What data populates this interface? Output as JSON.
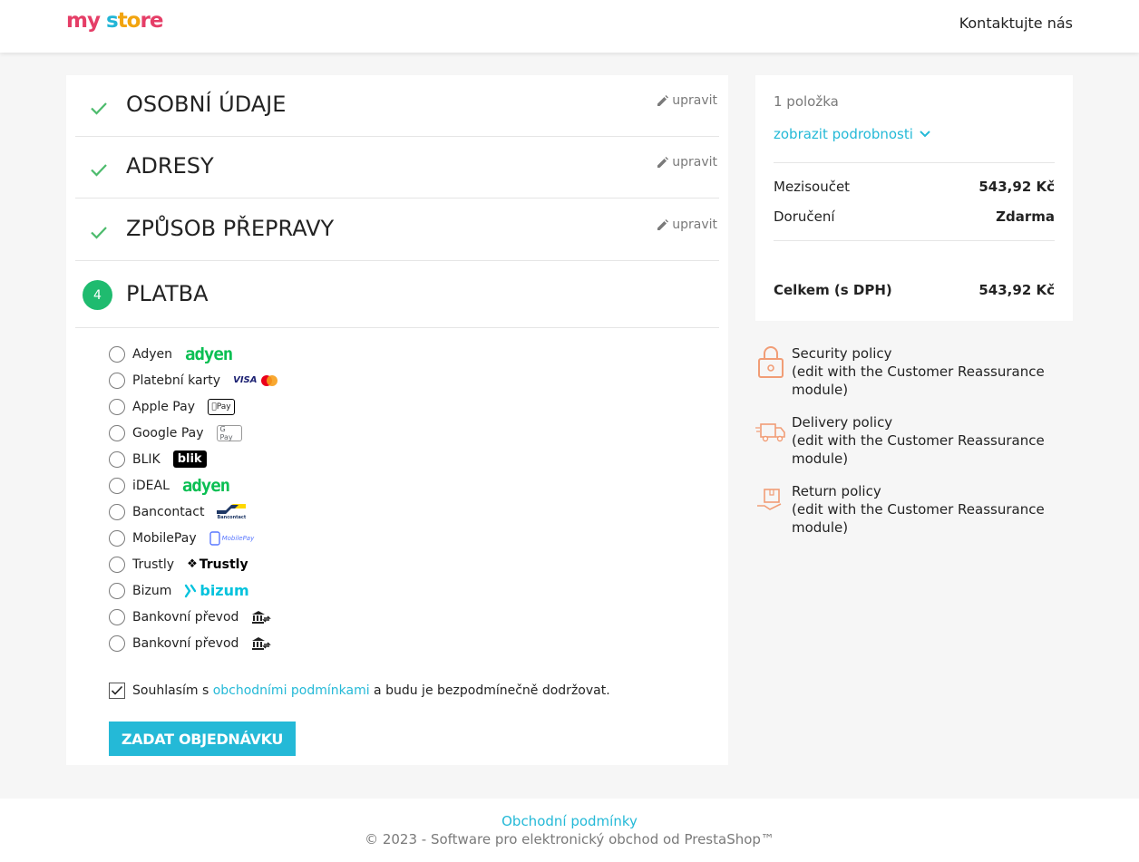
{
  "header": {
    "logo": {
      "part1": "my",
      "part2": " ",
      "part3": "s",
      "part4": "to",
      "part5": "re"
    },
    "contact": "Kontaktujte nás"
  },
  "steps": [
    {
      "title": "OSOBNÍ ÚDAJE",
      "edit": "upravit"
    },
    {
      "title": "ADRESY",
      "edit": "upravit"
    },
    {
      "title": "ZPŮSOB PŘEPRAVY",
      "edit": "upravit"
    },
    {
      "title": "PLATBA",
      "number": "4"
    }
  ],
  "payments": [
    {
      "label": "Adyen",
      "logo": "adyen"
    },
    {
      "label": "Platební karty",
      "logo": "VISA"
    },
    {
      "label": "Apple Pay",
      "logo": "Pay"
    },
    {
      "label": "Google Pay",
      "logo": "G Pay"
    },
    {
      "label": "BLIK",
      "logo": "blik"
    },
    {
      "label": "iDEAL",
      "logo": "adyen"
    },
    {
      "label": "Bancontact",
      "logo": "Bancontact"
    },
    {
      "label": "MobilePay",
      "logo": "MobilePay"
    },
    {
      "label": "Trustly",
      "logo": "Trustly"
    },
    {
      "label": "Bizum",
      "logo": "bizum"
    },
    {
      "label": "Bankovní převod",
      "logo": "bank-transfer-icon"
    },
    {
      "label": "Bankovní převod",
      "logo": "bank-transfer-icon"
    }
  ],
  "terms": {
    "before": "Souhlasím s ",
    "link": "obchodními podmínkami",
    "after": " a budu je bezpodmínečně dodržovat."
  },
  "order_button": "ZADAT OBJEDNÁVKU",
  "summary": {
    "items": "1 položka",
    "details": "zobrazit podrobnosti",
    "subtotal_label": "Mezisoučet",
    "subtotal_value": "543,92 Kč",
    "shipping_label": "Doručení",
    "shipping_value": "Zdarma",
    "total_label": "Celkem (s DPH)",
    "total_value": "543,92 Kč"
  },
  "reassurance": [
    {
      "title": "Security policy",
      "desc": "(edit with the Customer Reassurance module)",
      "icon": "lock-icon"
    },
    {
      "title": "Delivery policy",
      "desc": "(edit with the Customer Reassurance module)",
      "icon": "truck-icon"
    },
    {
      "title": "Return policy",
      "desc": "(edit with the Customer Reassurance module)",
      "icon": "return-box-icon"
    }
  ],
  "footer": {
    "link": "Obchodní podmínky",
    "copyright": "© 2023 - Software pro elektronický obchod od PrestaShop™"
  },
  "colors": {
    "accent": "#24b9d7",
    "success": "#1fbb6f",
    "check": "#4cbb6c"
  }
}
